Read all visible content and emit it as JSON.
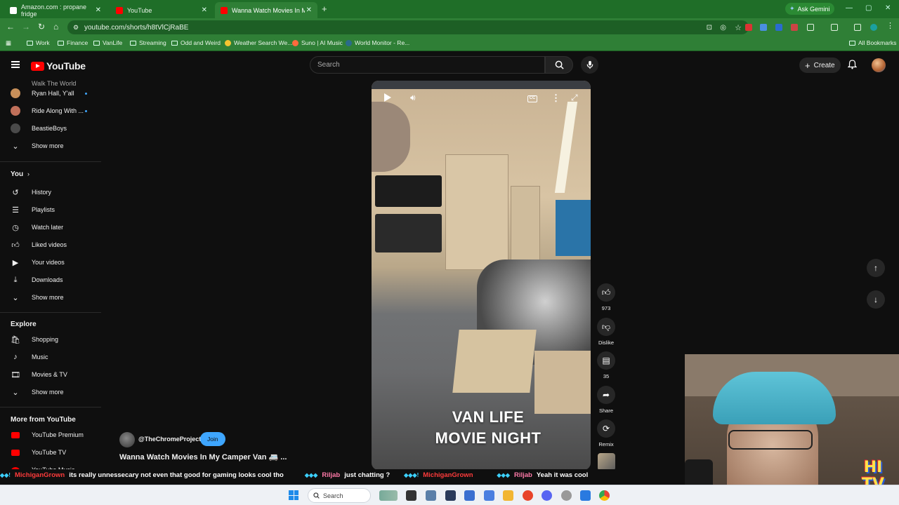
{
  "browser": {
    "tabs": [
      {
        "title": "Amazon.com : propane fridge",
        "active": false
      },
      {
        "title": "YouTube",
        "active": false
      },
      {
        "title": "Wanna Watch Movies In My Ca",
        "active": true
      }
    ],
    "ask_gemini": "Ask Gemini",
    "url": "youtube.com/shorts/h8tVlCjRaBE",
    "bookmarks": [
      "Work",
      "Finance",
      "VanLife",
      "Streaming",
      "Odd and Weird",
      "Weather Search We...",
      "Suno | AI Music",
      "World Monitor - Re..."
    ],
    "all_bookmarks": "All Bookmarks"
  },
  "youtube": {
    "logo_text": "YouTube",
    "search_placeholder": "Search",
    "create_label": "Create"
  },
  "sidebar": {
    "subscriptions": [
      {
        "label": "Walk The World",
        "dot": false
      },
      {
        "label": "Ryan Hall, Y'all",
        "dot": true
      },
      {
        "label": "Ride Along With ...",
        "dot": true
      },
      {
        "label": "BeastieBoys",
        "dot": false
      }
    ],
    "show_more": "Show more",
    "you_header": "You",
    "you_items": [
      "History",
      "Playlists",
      "Watch later",
      "Liked videos",
      "Your videos",
      "Downloads"
    ],
    "explore_header": "Explore",
    "explore_items": [
      "Shopping",
      "Music",
      "Movies & TV"
    ],
    "more_header": "More from YouTube",
    "more_items": [
      "YouTube Premium",
      "YouTube TV",
      "YouTube Music"
    ]
  },
  "short": {
    "overlay_line1": "VAN LIFE",
    "overlay_line2": "MOVIE NIGHT",
    "channel": "@TheChromeProject",
    "join_label": "Join",
    "title": "Wanna Watch Movies In My Camper Van 🚐 ...",
    "like_count": "973",
    "dislike_label": "Dislike",
    "comment_count": "35",
    "share_label": "Share",
    "remix_label": "Remix"
  },
  "chat_ticker": [
    {
      "user": "MichiganGrown",
      "message": "its really unnessecary not even that good for gaming looks cool tho"
    },
    {
      "user": "Riljab",
      "message": "just chatting ?"
    },
    {
      "user": "MichiganGrown",
      "message": ""
    },
    {
      "user": "Riljab",
      "message": "Yeah it was cool"
    }
  ],
  "taskbar": {
    "search_label": "Search"
  },
  "colors": {
    "chrome_green": "#2f7f36",
    "yt_red": "#ff0000",
    "join_blue": "#3ea6ff"
  }
}
